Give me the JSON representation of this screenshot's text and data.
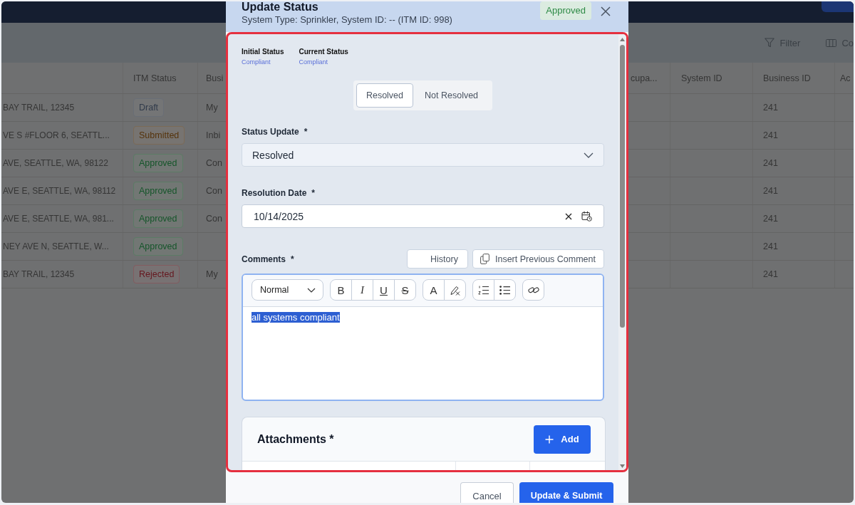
{
  "background": {
    "toolbar": [
      {
        "kind": "filter",
        "label": "Filter"
      },
      {
        "kind": "columns",
        "label": "Co"
      }
    ],
    "left_table": {
      "headers": [
        "ITM Status",
        "Busi"
      ],
      "rows": [
        {
          "column_1": "BAY TRAIL, 12345",
          "itm_status": {
            "label": "Draft",
            "color": "#313b4b"
          },
          "busi": "My"
        },
        {
          "column_1": "VE S #FLOOR 6, SEATTL...",
          "itm_status": {
            "label": "Submitted",
            "color": "#55330b"
          },
          "busi": "Inbi"
        },
        {
          "column_1": "AVE, SEATTLE, WA, 98122",
          "itm_status": {
            "label": "Approved",
            "color": "#15552a"
          },
          "busi": "Con"
        },
        {
          "column_1": "AVE E, SEATTLE, WA, 98112",
          "itm_status": {
            "label": "Approved",
            "color": "#15552a"
          },
          "busi": "Con"
        },
        {
          "column_1": "AVE E, SEATTLE, WA, 981...",
          "itm_status": {
            "label": "Approved",
            "color": "#15552a"
          },
          "busi": "Con"
        },
        {
          "column_1": "NEY AVE N, SEATTLE, W...",
          "itm_status": {
            "label": "Approved",
            "color": "#15552a"
          }
        },
        {
          "column_1": "BAY TRAIL, 12345",
          "itm_status": {
            "label": "Rejected",
            "color": "#65161e"
          },
          "busi": "My"
        }
      ]
    },
    "right_table": {
      "headers": [
        "cupa...",
        "System ID",
        "Business ID",
        "Ac"
      ],
      "rows": [
        {
          "business_id": "241"
        },
        {
          "business_id": "241"
        },
        {
          "business_id": "241"
        },
        {
          "business_id": "241"
        },
        {
          "business_id": "241"
        },
        {
          "business_id": "241"
        },
        {
          "business_id": "241"
        }
      ]
    }
  },
  "modal": {
    "title": "Update Status",
    "subtitle": "System Type: Sprinkler, System ID: -- (ITM ID: 998)",
    "status_badge": {
      "label": "Approved",
      "color": "#2e8a46"
    },
    "statuses": [
      {
        "label": "Initial Status",
        "value": "Compliant"
      },
      {
        "label": "Current Status",
        "value": "Compliant"
      }
    ],
    "segments": [
      {
        "label": "Resolved",
        "selected": true
      },
      {
        "label": "Not Resolved",
        "selected": false
      }
    ],
    "fields": [
      {
        "kind": "select",
        "label": "Status Update",
        "marker": "*",
        "value": "Resolved"
      },
      {
        "kind": "date",
        "label": "Resolution Date",
        "marker": "*",
        "value": "10/14/2025"
      }
    ],
    "comments": {
      "label": "Comments",
      "marker": "*",
      "buttons": [
        {
          "kind": "history",
          "label": "History"
        },
        {
          "kind": "insert",
          "label": "Insert Previous Comment"
        }
      ],
      "editor": {
        "format": "Normal",
        "tool_groups": [
          [
            {
              "kind": "bold",
              "glyph": "B"
            },
            {
              "kind": "italic",
              "glyph": "I"
            },
            {
              "kind": "underline",
              "glyph": "U"
            },
            {
              "kind": "strike",
              "glyph": "S"
            }
          ],
          [
            {
              "kind": "color",
              "glyph": "A"
            },
            {
              "kind": "clean"
            }
          ],
          [
            {
              "kind": "ordered"
            },
            {
              "kind": "bullet"
            }
          ],
          [
            {
              "kind": "link"
            }
          ]
        ],
        "text": "all systems compliant",
        "text_selected": true
      }
    },
    "attachments": {
      "title": "Attachments *",
      "add_button": "Add"
    },
    "footer_buttons": [
      {
        "kind": "secondary",
        "label": "Cancel"
      },
      {
        "kind": "primary",
        "label": "Update & Submit"
      }
    ]
  }
}
